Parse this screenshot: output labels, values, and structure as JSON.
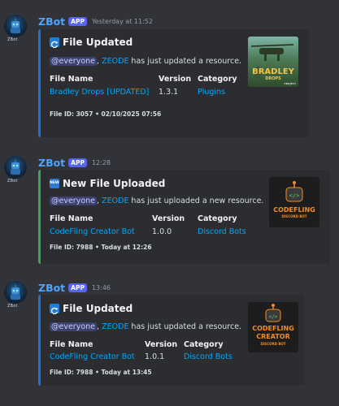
{
  "messages": [
    {
      "author": "ZBot",
      "badge": "APP",
      "timestamp": "Yesterday at 11:52",
      "avatar_label": "ZBot",
      "accent": "#1e74d6",
      "title_icon": "refresh-icon",
      "title": "File Updated",
      "mention": "@everyone",
      "user": "ZEODE",
      "action": "has just updated a resource.",
      "fields": {
        "name_label": "File Name",
        "name": "Bradley Drops [UPDATED]",
        "version_label": "Version",
        "version": "1.3.1",
        "category_label": "Category",
        "category": "Plugins"
      },
      "footer": "File ID: 3057 • 02/10/2025 07:56",
      "thumb_text": "BRADLEY",
      "thumb_subtext": "DROPS",
      "thumb_mark": "PROJECT"
    },
    {
      "author": "ZBot",
      "badge": "APP",
      "timestamp": "12:28",
      "avatar_label": "ZBot",
      "accent": "#3ba55c",
      "title_icon": "new-icon",
      "new_icon_text": "NEW",
      "title": "New File Uploaded",
      "mention": "@everyone",
      "user": "ZEODE",
      "action": "has just uploaded a new resource.",
      "fields": {
        "name_label": "File Name",
        "name": "CodeFling Creator Bot",
        "version_label": "Version",
        "version": "1.0.0",
        "category_label": "Category",
        "category": "Discord Bots"
      },
      "footer": "File ID: 7988 • Today at 12:26",
      "thumb_text": "CODEFLING",
      "thumb_subtext": "DISCORD BOT"
    },
    {
      "author": "ZBot",
      "badge": "APP",
      "timestamp": "13:46",
      "avatar_label": "ZBot",
      "accent": "#1e74d6",
      "title_icon": "refresh-icon",
      "title": "File Updated",
      "mention": "@everyone",
      "user": "ZEODE",
      "action": "has just updated a resource.",
      "fields": {
        "name_label": "File Name",
        "name": "CodeFling Creator Bot",
        "version_label": "Version",
        "version": "1.0.1",
        "category_label": "Category",
        "category": "Discord Bots"
      },
      "footer": "File ID: 7988 • Today at 13:45",
      "thumb_text": "CODEFLING",
      "thumb_text2": "CREATOR",
      "thumb_subtext": "DISCORD BOT"
    }
  ]
}
